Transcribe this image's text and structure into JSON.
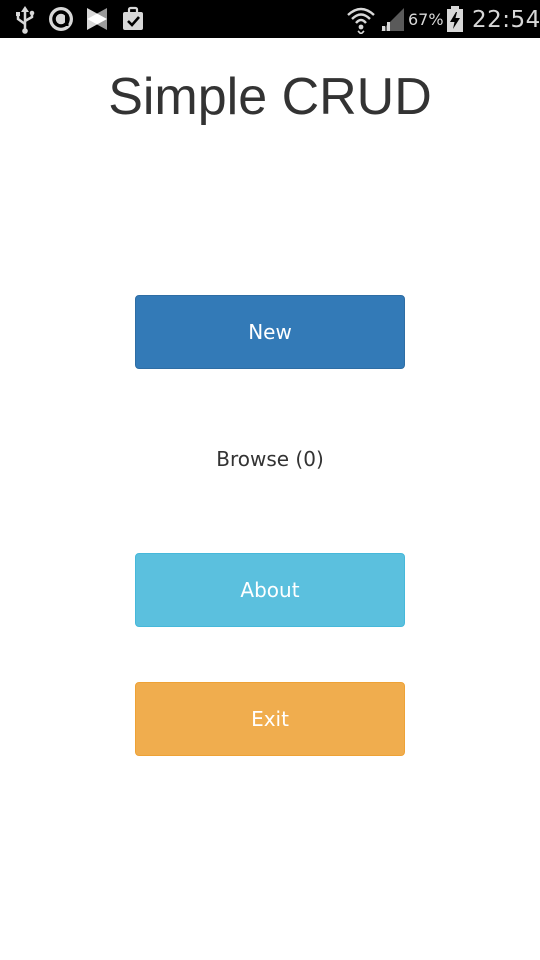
{
  "status_bar": {
    "icons_left": [
      "usb-icon",
      "app-a-icon",
      "cloud-sync-icon",
      "clipboard-check-icon"
    ],
    "icons_right": [
      "wifi-icon",
      "cell-signal-icon",
      "battery-charging-icon"
    ],
    "battery_percent": "67%",
    "time": "22:54"
  },
  "app": {
    "title": "Simple CRUD"
  },
  "menu": {
    "new_label": "New",
    "browse_label": "Browse (0)",
    "about_label": "About",
    "exit_label": "Exit"
  },
  "colors": {
    "new": "#337ab7",
    "about": "#5bc0de",
    "exit": "#f0ad4e",
    "text": "#333333",
    "status_bar": "#000000"
  }
}
